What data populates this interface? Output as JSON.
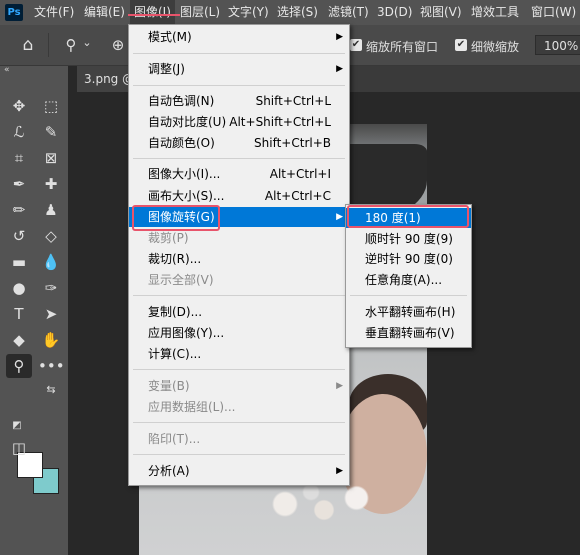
{
  "menubar": {
    "logo": "Ps",
    "items": [
      "文件(F)",
      "编辑(E)",
      "图像(I)",
      "图层(L)",
      "文字(Y)",
      "选择(S)",
      "滤镜(T)",
      "3D(D)",
      "视图(V)",
      "增效工具",
      "窗口(W)"
    ]
  },
  "options": {
    "check1": "✔",
    "label1": "缩放所有窗口",
    "check2": "✔",
    "label2": "细微缩放",
    "zoom": "100%"
  },
  "document": {
    "tab_title": "3.png @"
  },
  "image_menu": [
    {
      "label": "模式(M)",
      "shortcut": "",
      "submenu": true,
      "disabled": false
    },
    {
      "label": "调整(J)",
      "shortcut": "",
      "submenu": true,
      "disabled": false
    },
    {
      "label": "自动色调(N)",
      "shortcut": "Shift+Ctrl+L",
      "submenu": false,
      "disabled": false
    },
    {
      "label": "自动对比度(U)",
      "shortcut": "Alt+Shift+Ctrl+L",
      "submenu": false,
      "disabled": false
    },
    {
      "label": "自动颜色(O)",
      "shortcut": "Shift+Ctrl+B",
      "submenu": false,
      "disabled": false
    },
    {
      "label": "图像大小(I)...",
      "shortcut": "Alt+Ctrl+I",
      "submenu": false,
      "disabled": false
    },
    {
      "label": "画布大小(S)...",
      "shortcut": "Alt+Ctrl+C",
      "submenu": false,
      "disabled": false
    },
    {
      "label": "图像旋转(G)",
      "shortcut": "",
      "submenu": true,
      "disabled": false
    },
    {
      "label": "裁剪(P)",
      "shortcut": "",
      "submenu": false,
      "disabled": true
    },
    {
      "label": "裁切(R)...",
      "shortcut": "",
      "submenu": false,
      "disabled": false
    },
    {
      "label": "显示全部(V)",
      "shortcut": "",
      "submenu": false,
      "disabled": true
    },
    {
      "label": "复制(D)...",
      "shortcut": "",
      "submenu": false,
      "disabled": false
    },
    {
      "label": "应用图像(Y)...",
      "shortcut": "",
      "submenu": false,
      "disabled": false
    },
    {
      "label": "计算(C)...",
      "shortcut": "",
      "submenu": false,
      "disabled": false
    },
    {
      "label": "变量(B)",
      "shortcut": "",
      "submenu": true,
      "disabled": true
    },
    {
      "label": "应用数据组(L)...",
      "shortcut": "",
      "submenu": false,
      "disabled": true
    },
    {
      "label": "陷印(T)...",
      "shortcut": "",
      "submenu": false,
      "disabled": true
    },
    {
      "label": "分析(A)",
      "shortcut": "",
      "submenu": true,
      "disabled": false
    }
  ],
  "rotate_submenu": [
    {
      "label": "180 度(1)"
    },
    {
      "label": "顺时针 90 度(9)"
    },
    {
      "label": "逆时针 90 度(0)"
    },
    {
      "label": "任意角度(A)..."
    },
    {
      "label": "水平翻转画布(H)"
    },
    {
      "label": "垂直翻转画布(V)"
    }
  ],
  "icons": {
    "submenu_arrow": "▶",
    "collapse": "«",
    "home": "⌂",
    "zoom": "⚲",
    "dropdown": "⌄",
    "zoom_in": "⊕"
  }
}
